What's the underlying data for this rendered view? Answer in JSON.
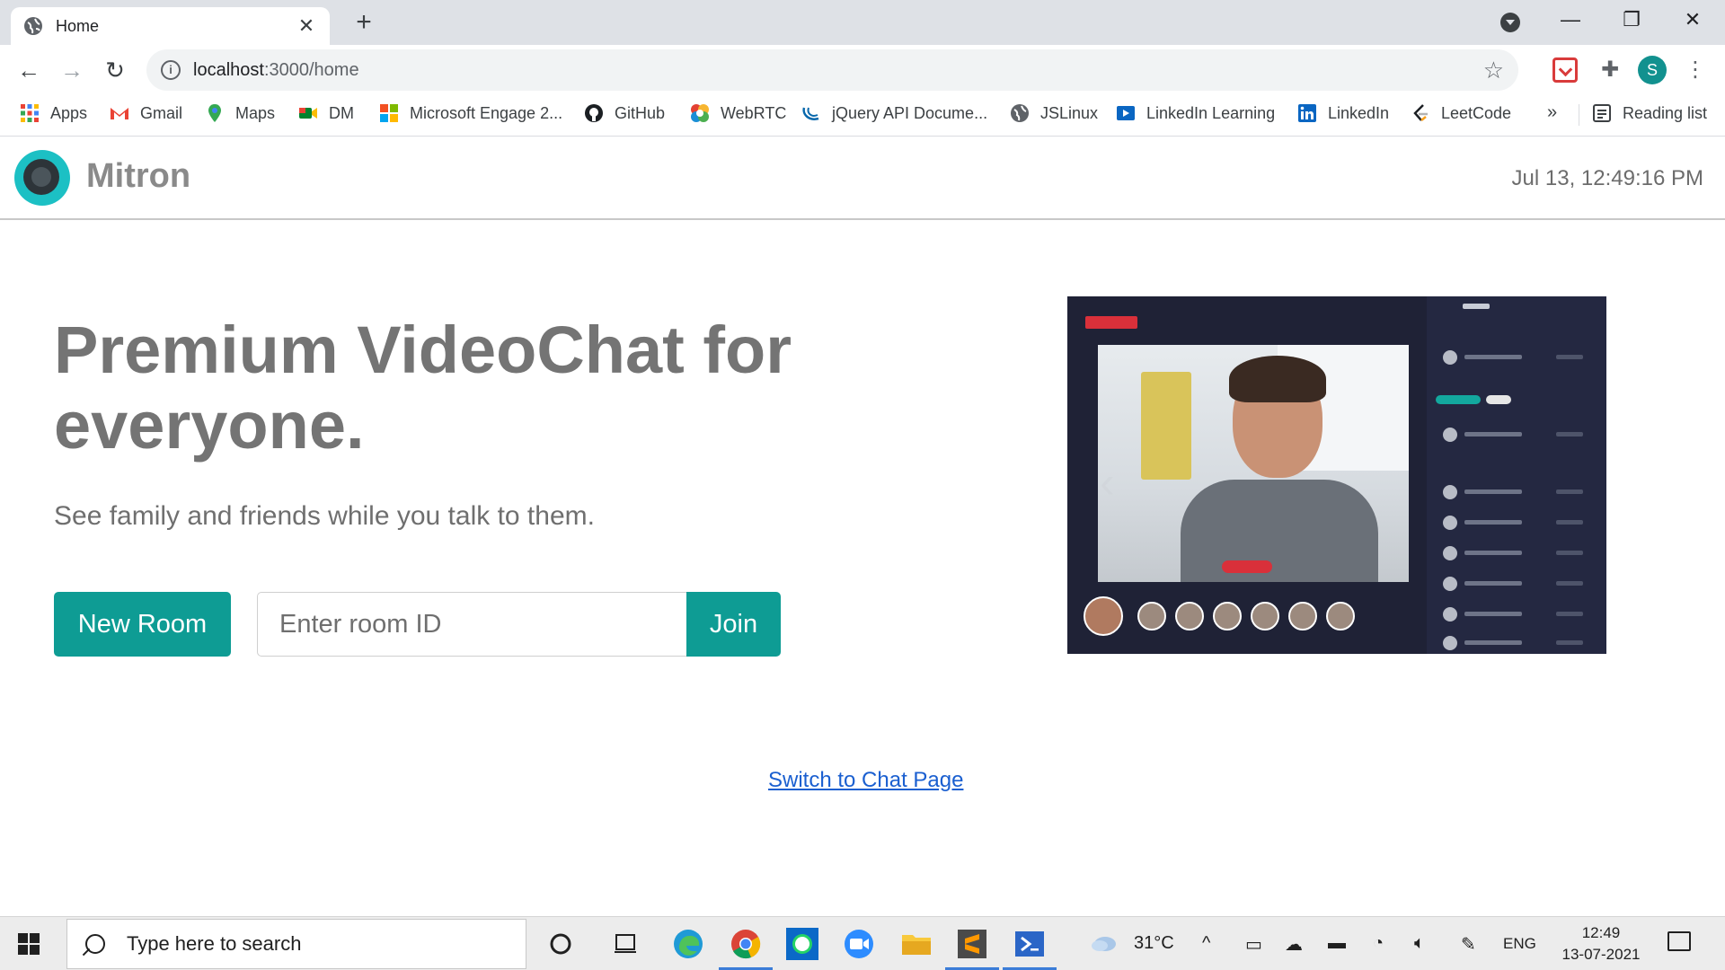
{
  "browser": {
    "tab": {
      "title": "Home",
      "close": "✕"
    },
    "new_tab": "+",
    "window_controls": {
      "minimize": "—",
      "restore": "❐",
      "close": "✕"
    },
    "nav": {
      "back": "←",
      "forward": "→",
      "reload": "↻"
    },
    "address": {
      "host": "localhost",
      "path": ":3000/home"
    },
    "star": "☆",
    "profile_initial": "S",
    "menu": "⋮",
    "bookmarks": [
      {
        "label": "Apps",
        "icon": "apps-grid-icon"
      },
      {
        "label": "Gmail",
        "icon": "gmail-icon"
      },
      {
        "label": "Maps",
        "icon": "maps-icon"
      },
      {
        "label": "DM",
        "icon": "meet-icon"
      },
      {
        "label": "Microsoft Engage 2...",
        "icon": "microsoft-icon"
      },
      {
        "label": "GitHub",
        "icon": "github-icon"
      },
      {
        "label": "WebRTC",
        "icon": "webrtc-icon"
      },
      {
        "label": "jQuery API Docume...",
        "icon": "jquery-icon"
      },
      {
        "label": "JSLinux",
        "icon": "globe-icon"
      },
      {
        "label": "LinkedIn Learning",
        "icon": "linkedin-learning-icon"
      },
      {
        "label": "LinkedIn",
        "icon": "linkedin-icon"
      },
      {
        "label": "LeetCode",
        "icon": "leetcode-icon"
      }
    ],
    "bookmarks_more": "»",
    "reading_list": "Reading list"
  },
  "app": {
    "brand": "Mitron",
    "clock": "Jul 13, 12:49:16 PM",
    "headline": "Premium VideoChat for everyone.",
    "subline": "See family and friends while you talk to them.",
    "new_room_label": "New Room",
    "room_input_placeholder": "Enter room ID",
    "join_label": "Join",
    "chat_link": "Switch to Chat Page"
  },
  "taskbar": {
    "search_placeholder": "Type here to search",
    "weather": "31°C",
    "language": "ENG",
    "time": "12:49",
    "date": "13-07-2021"
  },
  "colors": {
    "accent": "#0e9c94",
    "brand_text": "#8a8a8a",
    "link": "#1a5fd0",
    "logo_ring": "#1cc0c4"
  }
}
